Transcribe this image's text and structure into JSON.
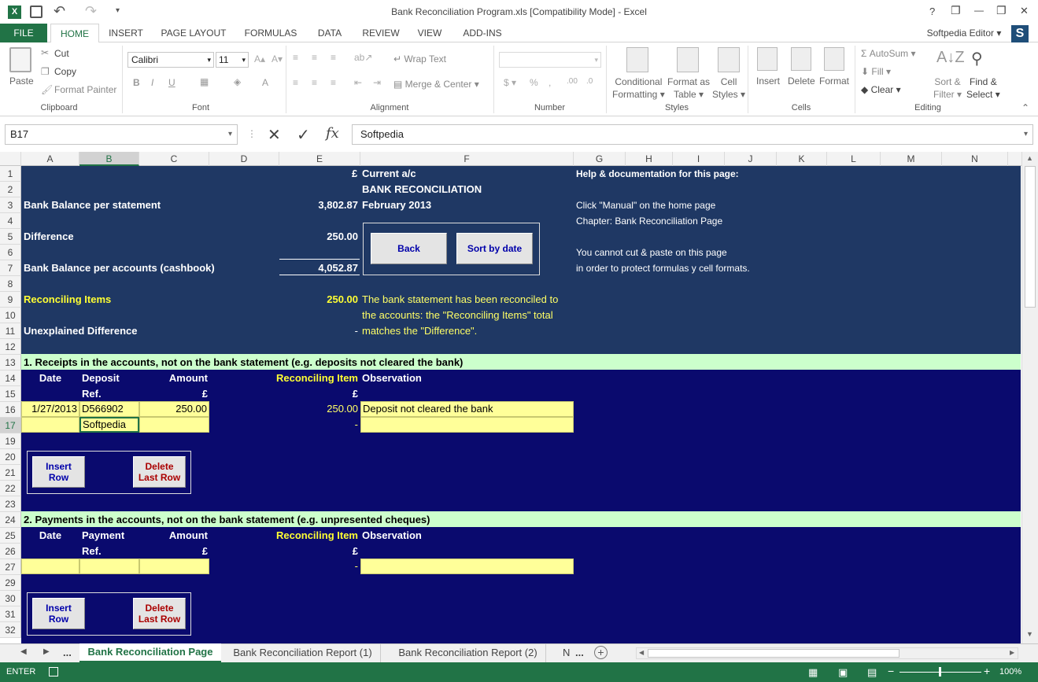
{
  "window": {
    "title": "Bank Reconciliation Program.xls  [Compatibility Mode] - Excel",
    "help": "?",
    "minimize": "—",
    "restore": "❐",
    "close": "✕"
  },
  "menu": {
    "file": "FILE",
    "tabs": [
      "HOME",
      "INSERT",
      "PAGE LAYOUT",
      "FORMULAS",
      "DATA",
      "REVIEW",
      "VIEW",
      "ADD-INS"
    ],
    "user": "Softpedia Editor",
    "user_badge": "S"
  },
  "ribbon": {
    "clipboard": {
      "paste": "Paste",
      "cut": "Cut",
      "copy": "Copy",
      "format_painter": "Format Painter",
      "label": "Clipboard"
    },
    "font": {
      "name": "Calibri",
      "size": "11",
      "label": "Font"
    },
    "alignment": {
      "wrap": "Wrap Text",
      "merge": "Merge & Center",
      "label": "Alignment"
    },
    "number": {
      "label": "Number"
    },
    "styles": {
      "cond1": "Conditional",
      "cond2": "Formatting",
      "fmt1": "Format as",
      "fmt2": "Table",
      "cell1": "Cell",
      "cell2": "Styles",
      "label": "Styles"
    },
    "cells": {
      "insert": "Insert",
      "delete": "Delete",
      "format": "Format",
      "label": "Cells"
    },
    "editing": {
      "autosum": "AutoSum",
      "fill": "Fill",
      "clear": "Clear",
      "sort1": "Sort &",
      "sort2": "Filter",
      "find1": "Find &",
      "find2": "Select",
      "label": "Editing"
    }
  },
  "formula_bar": {
    "name_box": "B17",
    "fx": "fx",
    "content": "Softpedia"
  },
  "columns": [
    "A",
    "B",
    "C",
    "D",
    "E",
    "F",
    "G",
    "H",
    "I",
    "J",
    "K",
    "L",
    "M",
    "N"
  ],
  "rows": [
    "1",
    "2",
    "3",
    "4",
    "5",
    "6",
    "7",
    "8",
    "9",
    "10",
    "11",
    "12",
    "13",
    "14",
    "15",
    "16",
    "17",
    "19",
    "20",
    "21",
    "22",
    "23",
    "24",
    "25",
    "26",
    "27",
    "29",
    "30",
    "31",
    "32"
  ],
  "sheet": {
    "e1": "£",
    "f1": "Current a/c",
    "f2": "BANK RECONCILIATION",
    "a3": "Bank Balance per statement",
    "e3": "3,802.87",
    "f3": "February 2013",
    "a5": "Difference",
    "e5": "250.00",
    "a7": "Bank Balance per accounts (cashbook)",
    "e7": "4,052.87",
    "a9": "Reconciling Items",
    "e9": "250.00",
    "f9": "The bank statement has been reconciled to",
    "f10": "the accounts: the \"Reconciling Items\" total",
    "a11": "Unexplained Difference",
    "e11": "-",
    "f11": "matches the \"Difference\".",
    "help1": "Help & documentation for this page:",
    "help3": "Click \"Manual\" on the home page",
    "help4": "Chapter: Bank Reconciliation Page",
    "help6": "You cannot cut & paste on this page",
    "help7": "in order to protect formulas y cell formats.",
    "btn_back": "Back",
    "btn_sort": "Sort by date",
    "s1_header": "1. Receipts in the accounts, not on the bank statement (e.g. deposits not cleared the bank)",
    "date": "Date",
    "deposit": "Deposit",
    "ref": "Ref.",
    "amount": "Amount",
    "pound": "£",
    "recon": "Reconciling Item",
    "observation": "Observation",
    "r16_date": "1/27/2013",
    "r16_ref": "D566902",
    "r16_amt": "250.00",
    "r16_recon": "250.00",
    "r16_obs": "Deposit not cleared the bank",
    "r17_ref": "Softpedia",
    "r17_recon": "-",
    "insert_row1": "Insert",
    "insert_row2": "Row",
    "delete_row1": "Delete",
    "delete_row2": "Last Row",
    "s2_header": "2. Payments in the accounts, not on the bank statement (e.g. unpresented cheques)",
    "payment": "Payment",
    "r27_recon": "-"
  },
  "sheet_tabs": {
    "more": "...",
    "active": "Bank Reconciliation Page",
    "t2": "Bank Reconciliation Report (1)",
    "t3": "Bank Reconciliation Report (2)",
    "t4": "N",
    "more2": "..."
  },
  "status": {
    "mode": "ENTER",
    "zoom": "100%"
  },
  "colors": {
    "navy_header": "#1f3864",
    "navy_body": "#0a0a6e",
    "green_band": "#ccffcc",
    "excel_green": "#217346"
  }
}
